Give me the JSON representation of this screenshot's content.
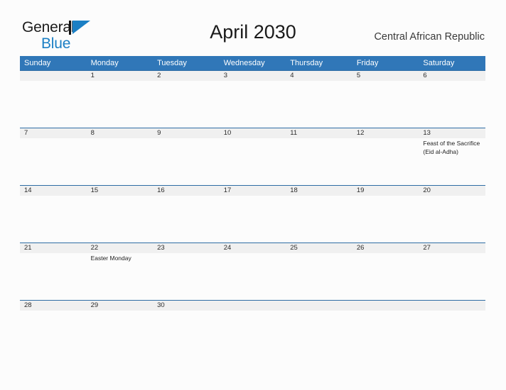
{
  "brand": {
    "line1": "General",
    "line2": "Blue",
    "mark": "triangle-icon",
    "color_dark": "#1c1c1c",
    "color_blue": "#1b7fc4"
  },
  "header": {
    "title": "April 2030",
    "country": "Central African Republic"
  },
  "theme": {
    "header_blue": "#3077b8",
    "strip_gray": "#f0f0f0",
    "strip_border": "#2e6da4",
    "page_bg": "#fcfcfc"
  },
  "calendar": {
    "weekday_headers": [
      "Sunday",
      "Monday",
      "Tuesday",
      "Wednesday",
      "Thursday",
      "Friday",
      "Saturday"
    ],
    "weeks": [
      [
        {
          "date": "",
          "events": []
        },
        {
          "date": "1",
          "events": []
        },
        {
          "date": "2",
          "events": []
        },
        {
          "date": "3",
          "events": []
        },
        {
          "date": "4",
          "events": []
        },
        {
          "date": "5",
          "events": []
        },
        {
          "date": "6",
          "events": []
        }
      ],
      [
        {
          "date": "7",
          "events": []
        },
        {
          "date": "8",
          "events": []
        },
        {
          "date": "9",
          "events": []
        },
        {
          "date": "10",
          "events": []
        },
        {
          "date": "11",
          "events": []
        },
        {
          "date": "12",
          "events": []
        },
        {
          "date": "13",
          "events": [
            "Feast of the Sacrifice (Eid al-Adha)"
          ]
        }
      ],
      [
        {
          "date": "14",
          "events": []
        },
        {
          "date": "15",
          "events": []
        },
        {
          "date": "16",
          "events": []
        },
        {
          "date": "17",
          "events": []
        },
        {
          "date": "18",
          "events": []
        },
        {
          "date": "19",
          "events": []
        },
        {
          "date": "20",
          "events": []
        }
      ],
      [
        {
          "date": "21",
          "events": []
        },
        {
          "date": "22",
          "events": [
            "Easter Monday"
          ]
        },
        {
          "date": "23",
          "events": []
        },
        {
          "date": "24",
          "events": []
        },
        {
          "date": "25",
          "events": []
        },
        {
          "date": "26",
          "events": []
        },
        {
          "date": "27",
          "events": []
        }
      ],
      [
        {
          "date": "28",
          "events": []
        },
        {
          "date": "29",
          "events": []
        },
        {
          "date": "30",
          "events": []
        },
        {
          "date": "",
          "events": []
        },
        {
          "date": "",
          "events": []
        },
        {
          "date": "",
          "events": []
        },
        {
          "date": "",
          "events": []
        }
      ]
    ]
  }
}
